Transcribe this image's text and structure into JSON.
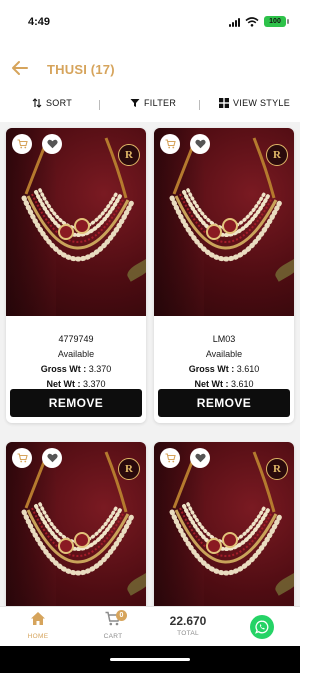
{
  "status_bar": {
    "time": "4:49",
    "battery": "100"
  },
  "header": {
    "title": "THUSI (17)"
  },
  "toolbar": {
    "sort_label": "SORT",
    "filter_label": "FILTER",
    "view_label": "VIEW STYLE"
  },
  "products": [
    {
      "code": "4779749",
      "status": "Available",
      "gross_label": "Gross Wt :",
      "gross": "3.370",
      "net_label": "Net Wt :",
      "net": "3.370",
      "remove_label": "REMOVE",
      "brand": "R"
    },
    {
      "code": "LM03",
      "status": "Available",
      "gross_label": "Gross Wt :",
      "gross": "3.610",
      "net_label": "Net Wt :",
      "net": "3.610",
      "remove_label": "REMOVE",
      "brand": "R"
    },
    {
      "brand": "R"
    },
    {
      "brand": "R"
    }
  ],
  "bottom_nav": {
    "home_label": "HOME",
    "cart_label": "CART",
    "cart_count": "0",
    "total_value": "22.670",
    "total_label": "TOTAL"
  },
  "colors": {
    "accent": "#d6a45c",
    "button": "#0d0d0d",
    "whatsapp": "#25d366"
  }
}
